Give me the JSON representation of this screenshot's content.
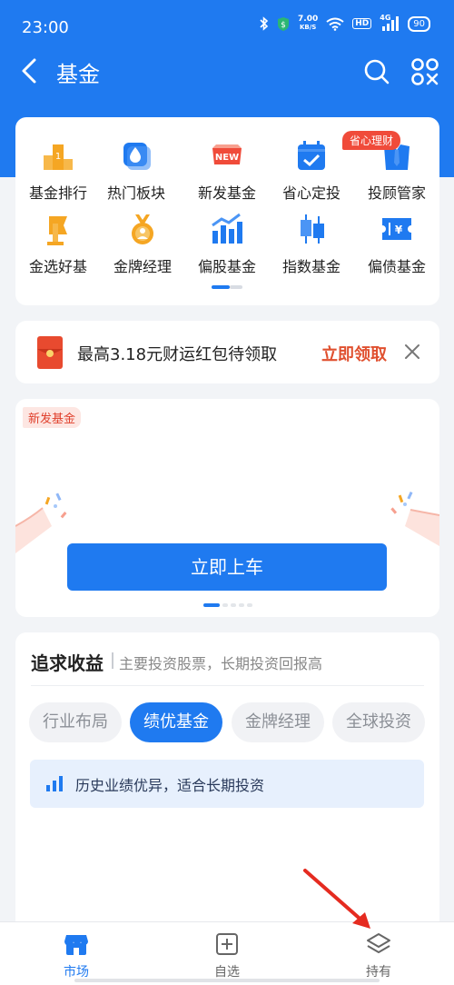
{
  "status_bar": {
    "time": "23:00",
    "net_speed_value": "7.00",
    "net_speed_unit": "KB/S",
    "hd_label": "HD",
    "network_type": "4G",
    "battery": "90",
    "icons": [
      "bluetooth-icon",
      "vpn-shield-icon",
      "wifi-icon",
      "signal-icon",
      "battery-icon"
    ]
  },
  "header": {
    "title": "基金",
    "icons": [
      "back-arrow-icon",
      "search-icon",
      "scan-icon"
    ]
  },
  "quick_grid": {
    "badge": "省心理财",
    "items": [
      {
        "label": "基金排行",
        "icon": "ranking-podium-icon",
        "color": "#f5a623"
      },
      {
        "label": "热门板块",
        "icon": "hot-drop-icon",
        "color": "#1f7af0"
      },
      {
        "label": "新发基金",
        "icon": "new-badge-icon",
        "color": "#f04b3a"
      },
      {
        "label": "省心定投",
        "icon": "calendar-check-icon",
        "color": "#1f7af0"
      },
      {
        "label": "投顾管家",
        "icon": "suit-icon",
        "color": "#1f7af0"
      },
      {
        "label": "金选好基",
        "icon": "trophy-flag-icon",
        "color": "#f5a623"
      },
      {
        "label": "金牌经理",
        "icon": "medal-icon",
        "color": "#f5a623"
      },
      {
        "label": "偏股基金",
        "icon": "bar-chart-icon",
        "color": "#1f7af0"
      },
      {
        "label": "指数基金",
        "icon": "candlestick-icon",
        "color": "#1f7af0"
      },
      {
        "label": "偏债基金",
        "icon": "bond-ticket-icon",
        "color": "#1f7af0"
      }
    ]
  },
  "promo": {
    "text": "最高3.18元财运红包待领取",
    "action": "立即领取",
    "icon": "red-envelope-icon",
    "action_color": "#e0502f"
  },
  "banner": {
    "tag": "新发基金",
    "button": "立即上车"
  },
  "invest": {
    "title": "追求收益",
    "subtitle": "主要投资股票，长期投资回报高",
    "chips": [
      {
        "label": "行业布局",
        "active": false
      },
      {
        "label": "绩优基金",
        "active": true
      },
      {
        "label": "金牌经理",
        "active": false
      },
      {
        "label": "全球投资",
        "active": false
      }
    ],
    "tip": "历史业绩优异，适合长期投资"
  },
  "tab_bar": {
    "tabs": [
      {
        "label": "市场",
        "icon": "market-store-icon",
        "active": true
      },
      {
        "label": "自选",
        "icon": "add-favorite-icon",
        "active": false
      },
      {
        "label": "持有",
        "icon": "holdings-layers-icon",
        "active": false
      }
    ]
  },
  "colors": {
    "brand": "#1f7af0",
    "accent_red": "#f04b3a",
    "background": "#f2f4f7"
  }
}
